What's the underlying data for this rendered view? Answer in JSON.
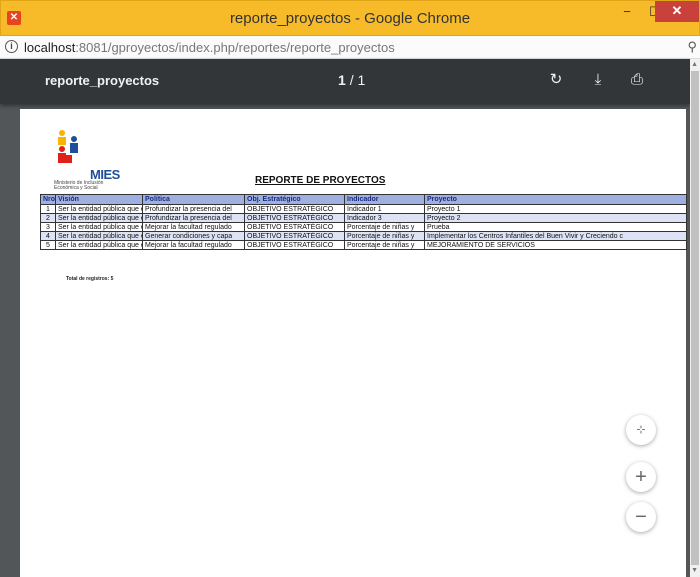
{
  "window": {
    "title": "reporte_proyectos - Google Chrome",
    "app_icon": "chrome-app-icon",
    "min_glyph": "−",
    "max_glyph": "☐",
    "close_glyph": "✕"
  },
  "address": {
    "info_glyph": "i",
    "host": "localhost",
    "path": ":8081/gproyectos/index.php/reportes/reporte_proyectos",
    "zoom_glyph": "⚲"
  },
  "viewer": {
    "doc_title": "reporte_proyectos",
    "page_current": "1",
    "page_sep": "/",
    "page_total": "1",
    "rotate_glyph": "↻",
    "download_glyph": "⤓",
    "print_glyph": "⎙",
    "fit_glyph": "⊹",
    "zoom_in_glyph": "+",
    "zoom_out_glyph": "−"
  },
  "report": {
    "logo_text": "MIES",
    "logo_subtitle": "Ministerio de Inclusión Económica y Social",
    "title": "REPORTE DE PROYECTOS",
    "columns": [
      "Nro",
      "Visión",
      "Política",
      "Obj. Estratégico",
      "Indicador",
      "Proyecto"
    ],
    "rows": [
      [
        "1",
        "Ser la entidad pública que e",
        "Profundizar la presencia del",
        "OBJETIVO ESTRATÉGICO",
        "Indicador 1",
        "Proyecto 1"
      ],
      [
        "2",
        "Ser la entidad pública que e",
        "Profundizar la presencia del",
        "OBJETIVO ESTRATÉGICO",
        "Indicador 3",
        "Proyecto 2"
      ],
      [
        "3",
        "Ser la entidad pública que e",
        "Mejorar la facultad regulado",
        "OBJETIVO ESTRATÉGICO",
        "Porcentaje de niñas y",
        "Prueba"
      ],
      [
        "4",
        "Ser la entidad pública que e",
        "Generar condiciones y capa",
        "OBJETIVO ESTRATÉGICO",
        "Porcentaje de niñas y",
        "Implementar los Centros Infantiles del Buen Vivir y Creciendo c"
      ],
      [
        "5",
        "Ser la entidad pública que e",
        "Mejorar la facultad regulado",
        "OBJETIVO ESTRATÉGICO",
        "Porcentaje de niñas y",
        "MEJORAMIENTO DE SERVICIOS"
      ]
    ],
    "total_label": "Total de registros: 5"
  },
  "colors": {
    "titlebar": "#f7bb2a",
    "toolbar": "#323639",
    "viewer_bg": "#525659",
    "header_bg": "#9fb0e0",
    "alt_row_bg": "#dde3f4",
    "close_btn": "#c9413b"
  }
}
